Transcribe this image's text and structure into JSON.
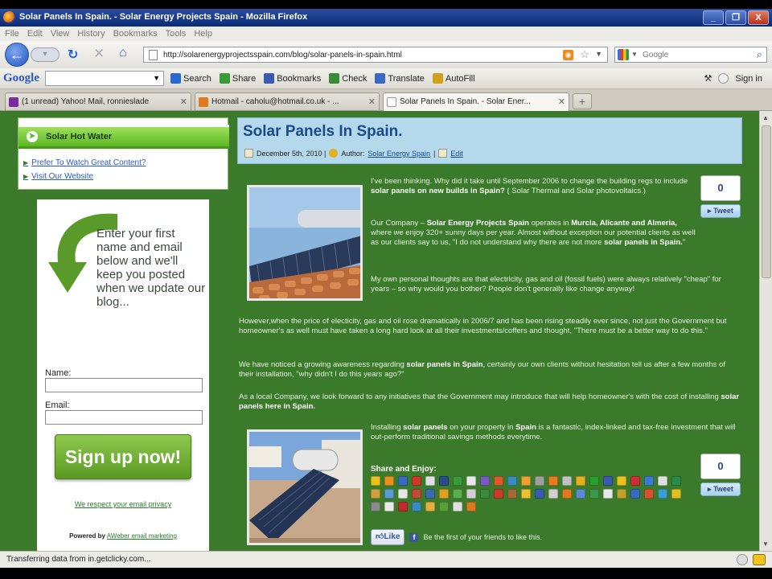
{
  "window": {
    "title": "Solar Panels In Spain. - Solar Energy Projects Spain - Mozilla Firefox",
    "controls": [
      "_",
      "❐",
      "X"
    ]
  },
  "menu": [
    "File",
    "Edit",
    "View",
    "History",
    "Bookmarks",
    "Tools",
    "Help"
  ],
  "nav": {
    "url": "http://solarenergyprojectsspain.com/blog/solar-panels-in-spain.html",
    "search_placeholder": "Google"
  },
  "google_toolbar": {
    "logo": "Google",
    "items": [
      {
        "label": "Search",
        "icon": "search-icon",
        "color": "#2a6ad0"
      },
      {
        "label": "Share",
        "icon": "share-icon",
        "color": "#3a9a3a"
      },
      {
        "label": "Bookmarks",
        "icon": "star-icon",
        "color": "#3a5ab0"
      },
      {
        "label": "Check",
        "icon": "check-icon",
        "color": "#3a8a3a"
      },
      {
        "label": "Translate",
        "icon": "translate-icon",
        "color": "#3a6ac0"
      },
      {
        "label": "AutoFill",
        "icon": "autofill-icon",
        "color": "#d0a020"
      }
    ],
    "signin": "Sign in"
  },
  "tabs": [
    {
      "label": "(1 unread) Yahoo! Mail, ronnieslade",
      "icon_color": "#7a2aa0"
    },
    {
      "label": "Hotmail - caholu@hotmail.co.uk - ...",
      "icon_color": "#e07a20"
    },
    {
      "label": "Solar Panels In Spain. - Solar Ener...",
      "icon_color": "#ffffff"
    }
  ],
  "sidebar": {
    "hotwater_label": "Solar Hot Water",
    "links": [
      "Prefer To Watch Great Content?",
      "Visit Our Website"
    ],
    "optin": {
      "message": "Enter your first name and email below and we'll keep you posted when we update our blog...",
      "name_label": "Name:",
      "email_label": "Email:",
      "signup": "Sign up now!",
      "privacy": "We respect your email privacy",
      "powered_prefix": "Powered by",
      "powered_link": "AWeber email marketing"
    }
  },
  "post": {
    "title": "Solar Panels In Spain.",
    "date": "December 5th, 2010 |",
    "author_prefix": "Author:",
    "author": "Solar Energy Spain",
    "edit": "Edit",
    "tweet_count_1": "0",
    "tweet_count_2": "0",
    "tweet_label": "Tweet",
    "p1_a": "I've been thinking. Why did it take until September 2006 to change the building regs to include ",
    "p1_b": "solar panels on new builds in Spain?",
    "p1_c": " ( Solar Thermal and Solar photovoltaics.)",
    "p2_a": "Our Company – ",
    "p2_b": "Solar Energy Projects Spain",
    "p2_c": " operates in ",
    "p2_d": "Murcia, Alicante and Almeria,",
    "p2_e": " where we enjoy 320+ sunny days per year. Almost without exception our potential clients as well as our clients say to us, \"I do not understand why there are not more ",
    "p2_f": "solar panels in Spain.",
    "p2_g": "\"",
    "p3": "My own personal thoughts are that electricity, gas and oil (fossil fuels) were always relatively \"cheap\" for years – so why would you bother? People don't generally like change anyway!",
    "p4": "However,when the price of electicity, gas and oil rose dramatically in 2006/7 and has been rising steadily ever since, not just the Government but homeowner's as well must have taken a long hard look at all their investments/coffers and thought, \"There must be a better way to do this.\"",
    "p5_a": "We have noticed a growing awareness regarding ",
    "p5_b": "solar panels in Spain",
    "p5_c": ", certainly our own clients without hesitation tell us after a few months of their installation, \"why didn't I do this years ago?\"",
    "p6_a": "As a local Company, we look forward to any initiatives that the Government may introduce that will help homeowner's with the cost of installing ",
    "p6_b": "solar panels here in Spain.",
    "p7_a": "Installing ",
    "p7_b": "solar panels",
    "p7_c": " on your property in ",
    "p7_d": "Spain",
    "p7_e": " is a fantastic, index-linked and tax-free investment that will out-perform traditional savings methods everytime.",
    "share_label": "Share and Enjoy:",
    "share_colors": [
      "#e8c020",
      "#e89020",
      "#3a6ac0",
      "#c83a2a",
      "#e0e0e0",
      "#2a4a8a",
      "#3a9a3a",
      "#e8e8e8",
      "#7a5ac0",
      "#d85a2a",
      "#3a8ac0",
      "#e8a030",
      "#a0a0a0",
      "#e87a20",
      "#c0c0c0",
      "#e0b020",
      "#2aa02a",
      "#3a5ab0",
      "#e8c020",
      "#c83030",
      "#3a7ad0",
      "#e0e0e0",
      "#2a8a4a",
      "#d0a040",
      "#5a9ad0",
      "#e8e8e8",
      "#c04a3a",
      "#3a6ab0",
      "#e0a020",
      "#5ab04a",
      "#d0d0d0",
      "#3a8a3a",
      "#c83a2a",
      "#a06a3a",
      "#e8c030",
      "#3a5ab0",
      "#d0d0d0",
      "#e07a20",
      "#5a8ad0",
      "#3a9a4a",
      "#e8e8e8",
      "#c0a030",
      "#3a6ac0",
      "#d85030",
      "#3aa0d0",
      "#e0c020",
      "#8a8a8a",
      "#e8e8e8",
      "#c02a2a",
      "#3a8ac0",
      "#e0b040",
      "#5aa03a",
      "#e0e0e0",
      "#d87a20"
    ],
    "like": "Like",
    "like_text": "Be the first of your friends to like this."
  },
  "status": "Transferring data from in.getclicky.com..."
}
